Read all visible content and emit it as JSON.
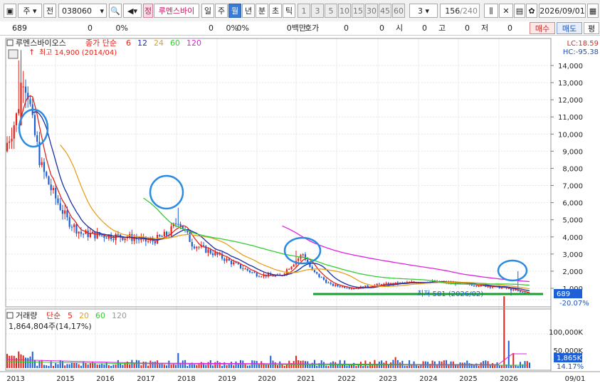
{
  "toolbar": {
    "market": "주",
    "code_label": "전",
    "code": "038060",
    "stock_name": "루멘스바이",
    "stock_badge": "정",
    "periods": [
      "일",
      "주",
      "월",
      "년",
      "분",
      "초",
      "틱"
    ],
    "active_period": "월",
    "intervals": [
      "1",
      "3",
      "5",
      "10",
      "15",
      "30",
      "45",
      "60"
    ],
    "interval_count": "3",
    "bar_count": "156",
    "bar_total": "/240",
    "date": "2026/09/01"
  },
  "quote": {
    "price": "689",
    "change": "0",
    "change_pct": "0%",
    "v1": "0",
    "v1_pct": "0%",
    "v2_pct": "0%",
    "amount": "0백만",
    "hoga_label": "호가",
    "hoga": "0",
    "v3": "0",
    "si_label": "시",
    "si": "0",
    "go_label": "고",
    "go": "0",
    "jeo_label": "저",
    "jeo": "0",
    "buy": "매수",
    "sell": "매도",
    "more": "평"
  },
  "price_panel": {
    "stock_label": "루멘스바이오스",
    "ma_label": "종가 단순",
    "ma_periods": [
      "6",
      "12",
      "24",
      "60",
      "120"
    ],
    "high_label": "최고 14,900 (2014/04)",
    "low_label": "최저 581 (2026/02)",
    "lc": "LC:18.59",
    "hc": "HC:-95.38",
    "current_tag": "689",
    "pct_tag": "-20.07%",
    "y_ticks": [
      "14,000",
      "13,000",
      "12,000",
      "11,000",
      "10,000",
      "9,000",
      "8,000",
      "7,000",
      "6,000",
      "5,000",
      "4,000",
      "3,000",
      "2,000",
      "1,000"
    ]
  },
  "volume_panel": {
    "label": "거래량",
    "ma_label": "단순",
    "ma_periods": [
      "5",
      "20",
      "60",
      "120"
    ],
    "value_line": "1,864,804주(14,17%)",
    "y_ticks": [
      "100,000K",
      "50,000K"
    ],
    "current_tag": "1,865K",
    "pct_tag": "14.17%"
  },
  "x_axis": [
    "2013",
    "2015",
    "2016",
    "2017",
    "2018",
    "2019",
    "2020",
    "2021",
    "2022",
    "2023",
    "2024",
    "2025",
    "2026",
    "09/01"
  ],
  "colors": {
    "up": "#e0241b",
    "down": "#1f5fd6",
    "ma6": "#e0241b",
    "ma12": "#1a2fa0",
    "ma24": "#e6a020",
    "ma60": "#33cc33",
    "ma120": "#e020e0",
    "circle": "#2b8be0",
    "support": "#17a030"
  },
  "chart_data": {
    "type": "candlestick",
    "x": [
      "2013",
      "2014",
      "2015",
      "2016",
      "2017",
      "2018",
      "2019",
      "2020",
      "2021",
      "2022",
      "2023",
      "2024",
      "2025",
      "2026"
    ],
    "close_approx": [
      9500,
      9500,
      4000,
      3800,
      3800,
      4000,
      2000,
      1800,
      2800,
      1100,
      1200,
      1000,
      850,
      689
    ],
    "high": 14900,
    "low": 581,
    "current": 689,
    "ylim": [
      0,
      15000
    ]
  }
}
